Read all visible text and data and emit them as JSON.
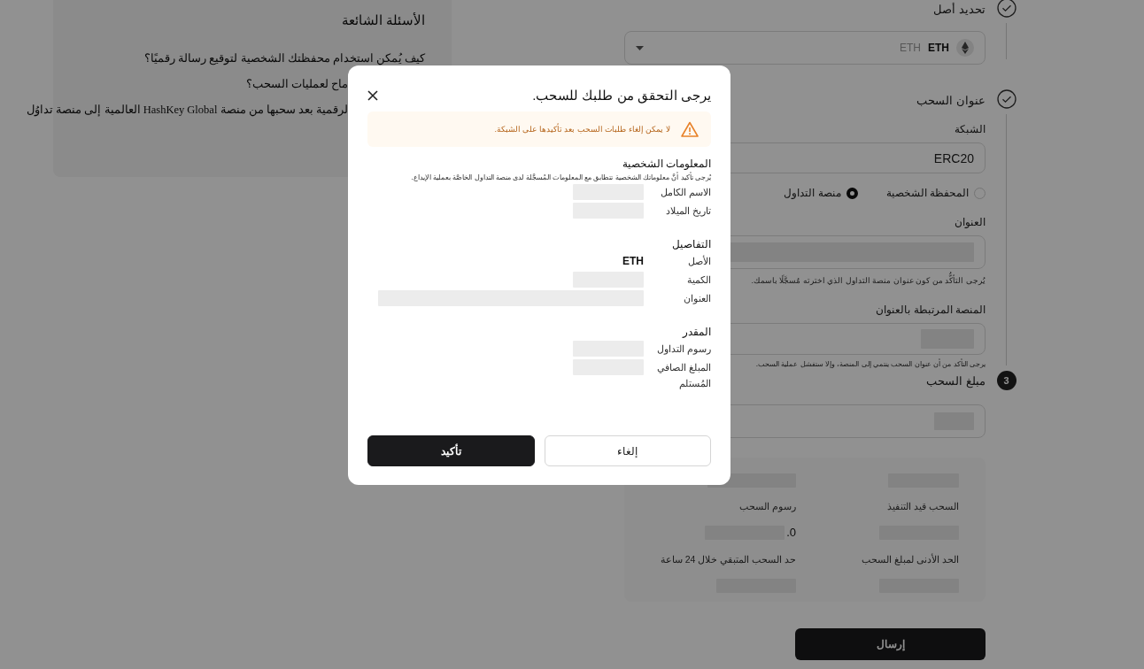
{
  "faq": {
    "title": "الأسئلة الشائعة",
    "questions": [
      {
        "text": "كيف يُمكن استخدام محفظتك الشخصية لتوقيع رسالة رقميًا؟",
        "kind": "full"
      },
      {
        "text": "ماح لعمليات السحب؟",
        "kind": "cut"
      },
      {
        "text": "لرقمية بعد سحبها من منصة HashKey Global العالمية إلى منصة تداوُل",
        "kind": "cut"
      }
    ]
  },
  "form": {
    "steps": [
      {
        "kind": "done",
        "title": "تحديد أصل"
      },
      {
        "kind": "done",
        "title": "عنوان السحب"
      },
      {
        "kind": "numbered",
        "number": "3",
        "title": "مبلغ السحب"
      }
    ],
    "asset_select": {
      "symbol": "ETH",
      "name": "ETH"
    },
    "network": {
      "label": "الشبكة",
      "value": "ERC20"
    },
    "address_type": [
      {
        "label": "المحفظة الشخصية",
        "selected": false
      },
      {
        "label": "منصة التداول",
        "selected": true
      }
    ],
    "address": {
      "label": "العنوان",
      "hint": "يُرجى التأكُّد من كون عنوان منصة التداول الذي اخترته مُسجَّلًا باسمك."
    },
    "platform": {
      "label": "المنصة المرتبطة بالعنوان",
      "hint": "يرجى التأكد من أن عنوان السحب ينتمي إلى المنصة، وإلا ستفشل عملية السحب."
    },
    "summary": [
      {
        "label": "السحب قيد التنفيذ",
        "kind": "redacted"
      },
      {
        "label": "رسوم السحب",
        "kind": "partial",
        "value": "0."
      },
      {
        "label": "الحد الأدنى لمبلغ السحب",
        "kind": "redacted"
      },
      {
        "label": "حد السحب المتبقي خلال 24 ساعة",
        "kind": "redacted"
      }
    ],
    "submit": "إرسال"
  },
  "dialog": {
    "title": "يرجى التحقق من طلبك للسحب.",
    "warning": "لا يمكن إلغاء طلبات السحب بعد تأكيدها على الشبكة.",
    "sections": [
      {
        "title": "المعلومات الشخصية",
        "note": "يُرجى تأكيد أنَّ معلوماتك الشخصية تتطابق مع المعلومات المُسجَّلة لدى منصة التداول الخاصَّة بعملية الإيداع.",
        "rows": [
          {
            "label": "الاسم الكامل",
            "kind": "redacted"
          },
          {
            "label": "تاريخ الميلاد",
            "kind": "redacted"
          }
        ]
      },
      {
        "title": "التفاصيل",
        "rows": [
          {
            "label": "الأصل",
            "kind": "text",
            "value": "ETH"
          },
          {
            "label": "الكمية",
            "kind": "redacted"
          },
          {
            "label": "العنوان",
            "kind": "redacted_long"
          }
        ]
      },
      {
        "title": "المقدر",
        "rows": [
          {
            "label": "رسوم التداول",
            "kind": "redacted"
          },
          {
            "label": "المبلغ الصافي المُستلم",
            "kind": "redacted"
          }
        ]
      }
    ],
    "buttons": [
      {
        "label": "إلغاء",
        "kind": "secondary"
      },
      {
        "label": "تأكيد",
        "kind": "primary"
      }
    ]
  }
}
